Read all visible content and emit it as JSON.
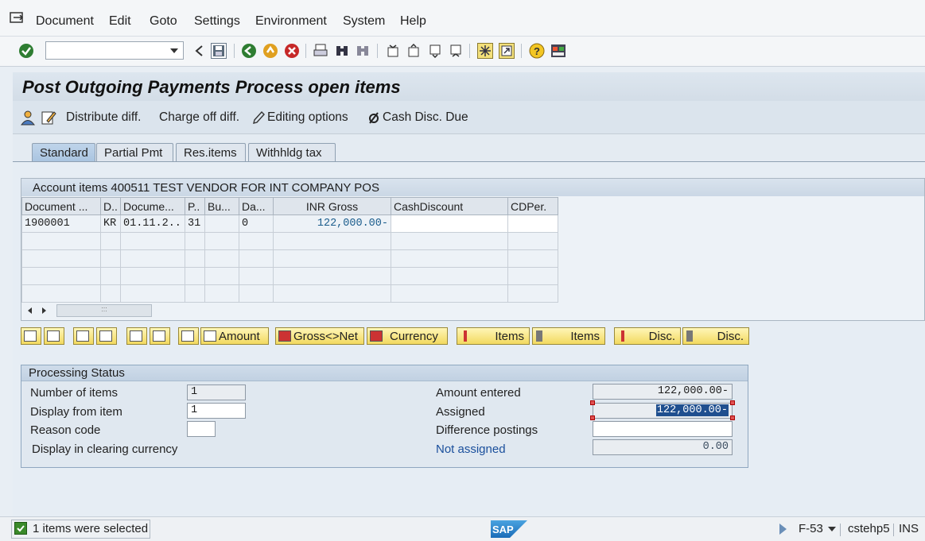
{
  "menu": {
    "items": [
      "Document",
      "Edit",
      "Goto",
      "Settings",
      "Environment",
      "System",
      "Help"
    ]
  },
  "toolbar": {
    "command_value": "",
    "icons": [
      "enter-icon",
      "back-icon",
      "save-icon",
      "back-green-icon",
      "exit-icon",
      "cancel-icon",
      "print-icon",
      "find-icon",
      "find-next-icon",
      "first-page-icon",
      "prev-page-icon",
      "next-page-icon",
      "last-page-icon",
      "create-session-icon",
      "shortcut-icon",
      "help-icon",
      "layout-icon"
    ]
  },
  "title": "Post Outgoing Payments Process open items",
  "app_toolbar": {
    "distribute": "Distribute diff.",
    "charge_off": "Charge off diff.",
    "editing": "Editing options",
    "cash_disc": "Cash Disc. Due"
  },
  "tabs": [
    "Standard",
    "Partial Pmt",
    "Res.items",
    "Withhldg tax"
  ],
  "table": {
    "header": "Account items 400511 TEST VENDOR FOR INT COMPANY POS",
    "columns": [
      "Document ...",
      "D..",
      "Docume...",
      "P..",
      "Bu...",
      "Da...",
      "INR Gross",
      "CashDiscount",
      "CDPer."
    ],
    "rows": [
      [
        "1900001",
        "KR",
        "01.11.2..",
        "31",
        "",
        "0",
        "122,000.00-",
        "",
        ""
      ]
    ]
  },
  "actions": {
    "amount": "Amount",
    "gross_net": "Gross<>Net",
    "currency": "Currency",
    "items1": "Items",
    "items2": "Items",
    "disc1": "Disc.",
    "disc2": "Disc."
  },
  "processing": {
    "title": "Processing Status",
    "num_items_label": "Number of items",
    "num_items_value": "1",
    "display_from_label": "Display from item",
    "display_from_value": "1",
    "reason_label": "Reason code",
    "reason_value": "",
    "display_clearing_label": "Display in clearing currency",
    "amount_entered_label": "Amount entered",
    "amount_entered_value": "122,000.00-",
    "assigned_label": "Assigned",
    "assigned_value": "122,000.00-",
    "diff_label": "Difference postings",
    "diff_value": "",
    "not_assigned_label": "Not assigned",
    "not_assigned_value": "0.00"
  },
  "status": {
    "message": "1 items were selected",
    "transaction": "F-53",
    "server": "cstehp5",
    "mode": "INS",
    "logo": "SAP"
  },
  "colors": {
    "title_bg": "#d3dde7",
    "tab_active": "#a9c4e0",
    "button_yellow": "#f2d95f",
    "link_blue": "#1a4f9c",
    "selection": "#1f4f8f"
  }
}
